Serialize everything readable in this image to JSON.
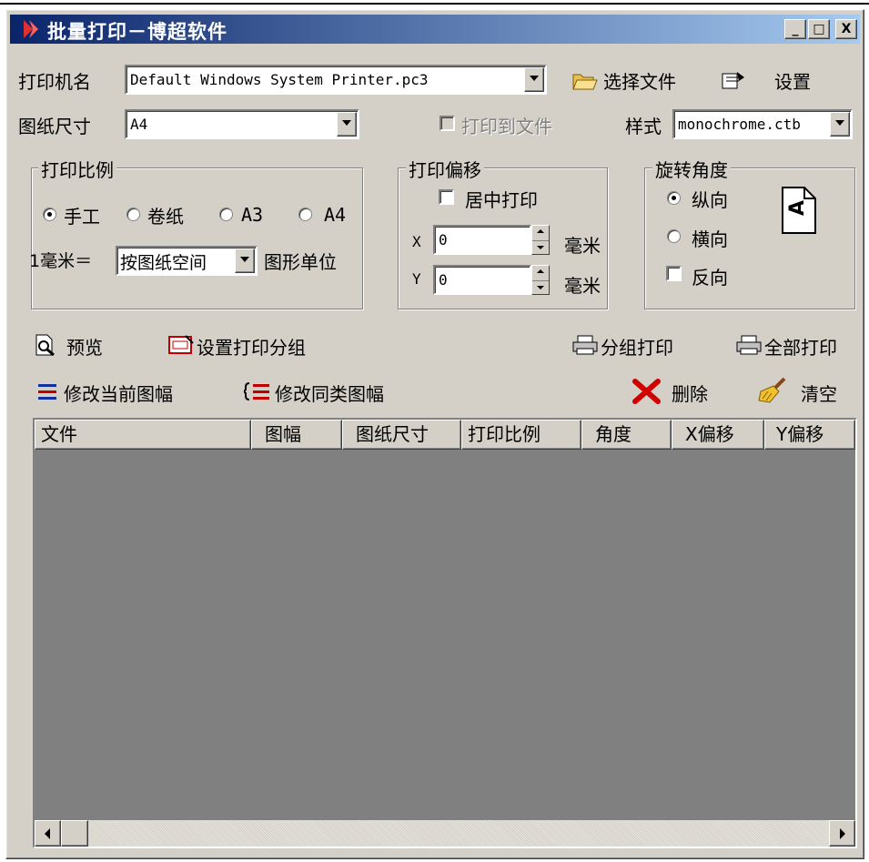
{
  "window": {
    "title": "批量打印－博超软件",
    "minimize_glyph": "_",
    "maximize_glyph": "□",
    "close_glyph": "X"
  },
  "printer": {
    "label": "打印机名",
    "value": "Default Windows System Printer.pc3",
    "select_file_label": "选择文件",
    "settings_label": "设置"
  },
  "paper": {
    "label": "图纸尺寸",
    "value": "A4",
    "print_to_file_label": "打印到文件",
    "style_label": "样式",
    "style_value": "monochrome.ctb"
  },
  "scale_group": {
    "title": "打印比例",
    "options": [
      "手工",
      "卷纸",
      "A3",
      "A4"
    ],
    "selected": "手工",
    "unit_prefix": "1毫米＝",
    "unit_value": "按图纸空间",
    "unit_suffix": "图形单位"
  },
  "offset_group": {
    "title": "打印偏移",
    "center_label": "居中打印",
    "x_label": "X",
    "x_value": "0",
    "y_label": "Y",
    "y_value": "0",
    "unit": "毫米"
  },
  "rotation_group": {
    "title": "旋转角度",
    "portrait_label": "纵向",
    "landscape_label": "横向",
    "reverse_label": "反向",
    "orientation_glyph": "A"
  },
  "toolbar": {
    "preview_label": "预览",
    "set_group_label": "设置打印分组",
    "group_print_label": "分组打印",
    "print_all_label": "全部打印",
    "modify_current_label": "修改当前图幅",
    "modify_similar_label": "修改同类图幅",
    "delete_label": "删除",
    "clear_label": "清空"
  },
  "table": {
    "columns": [
      "文件",
      "图幅",
      "图纸尺寸",
      "打印比例",
      "角度",
      "X偏移",
      "Y偏移"
    ]
  },
  "colors": {
    "window_bg": "#d4d0c8",
    "title_start": "#0a246a",
    "title_end": "#a6caf0",
    "list_bg": "#808080"
  }
}
